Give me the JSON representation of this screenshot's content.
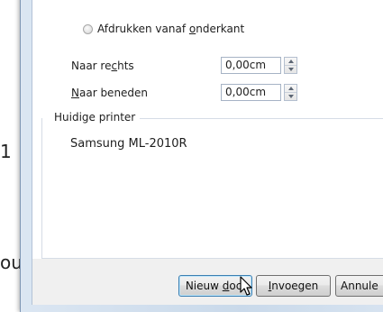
{
  "background": {
    "glyph_1": "1",
    "glyph_2": "ou"
  },
  "radio_print_bottom": {
    "label_before": "Afdrukken vanaf ",
    "label_mnemonic": "o",
    "label_after": "nderkant"
  },
  "offset_right": {
    "label_before": "Naar re",
    "label_mnemonic": "c",
    "label_after": "hts",
    "value": "0,00cm"
  },
  "offset_down": {
    "label_mnemonic": "N",
    "label_after": "aar beneden",
    "value": "0,00cm"
  },
  "current_printer": {
    "group_label": "Huidige printer",
    "printer_name": "Samsung ML-2010R"
  },
  "buttons": {
    "new_doc": {
      "label_before": "Nieuw ",
      "label_mnemonic": "d",
      "label_after": "oc."
    },
    "insert": {
      "label_mnemonic": "I",
      "label_after": "nvoegen"
    },
    "cancel": {
      "label": "Annule"
    }
  },
  "colors": {
    "frame": "#c9d9ea",
    "default_button_border": "#3c7fb1"
  },
  "icons": {
    "cursor": "arrow-pointer-icon",
    "spin": "spin-up-down-icon"
  }
}
